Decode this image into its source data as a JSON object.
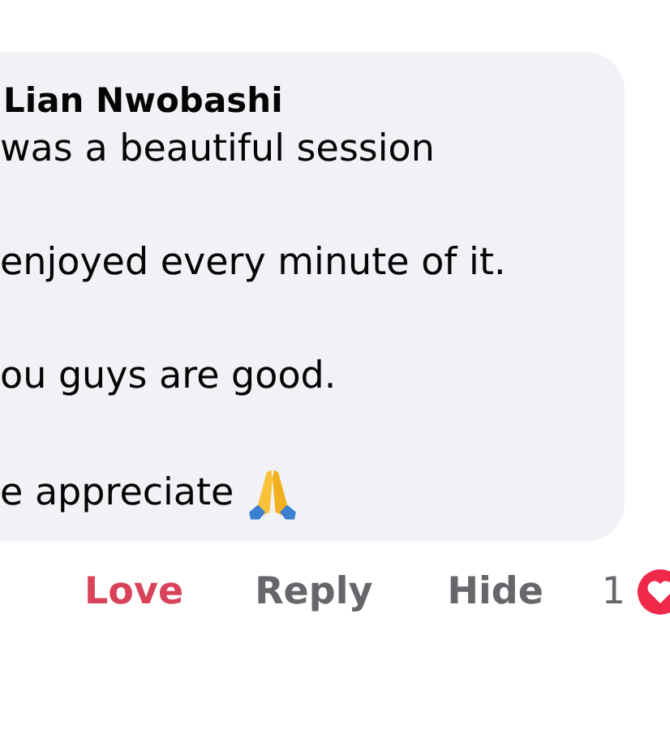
{
  "comment": {
    "author": "Lian Nwobashi",
    "paragraphs": [
      "was a beautiful session",
      "enjoyed every minute of it.",
      "ou guys are good.",
      "e appreciate"
    ]
  },
  "actions": [
    {
      "label": "Love",
      "selected": true
    },
    {
      "label": "Reply",
      "selected": false
    },
    {
      "label": "Hide",
      "selected": false
    }
  ],
  "reactions": {
    "count": "1"
  }
}
